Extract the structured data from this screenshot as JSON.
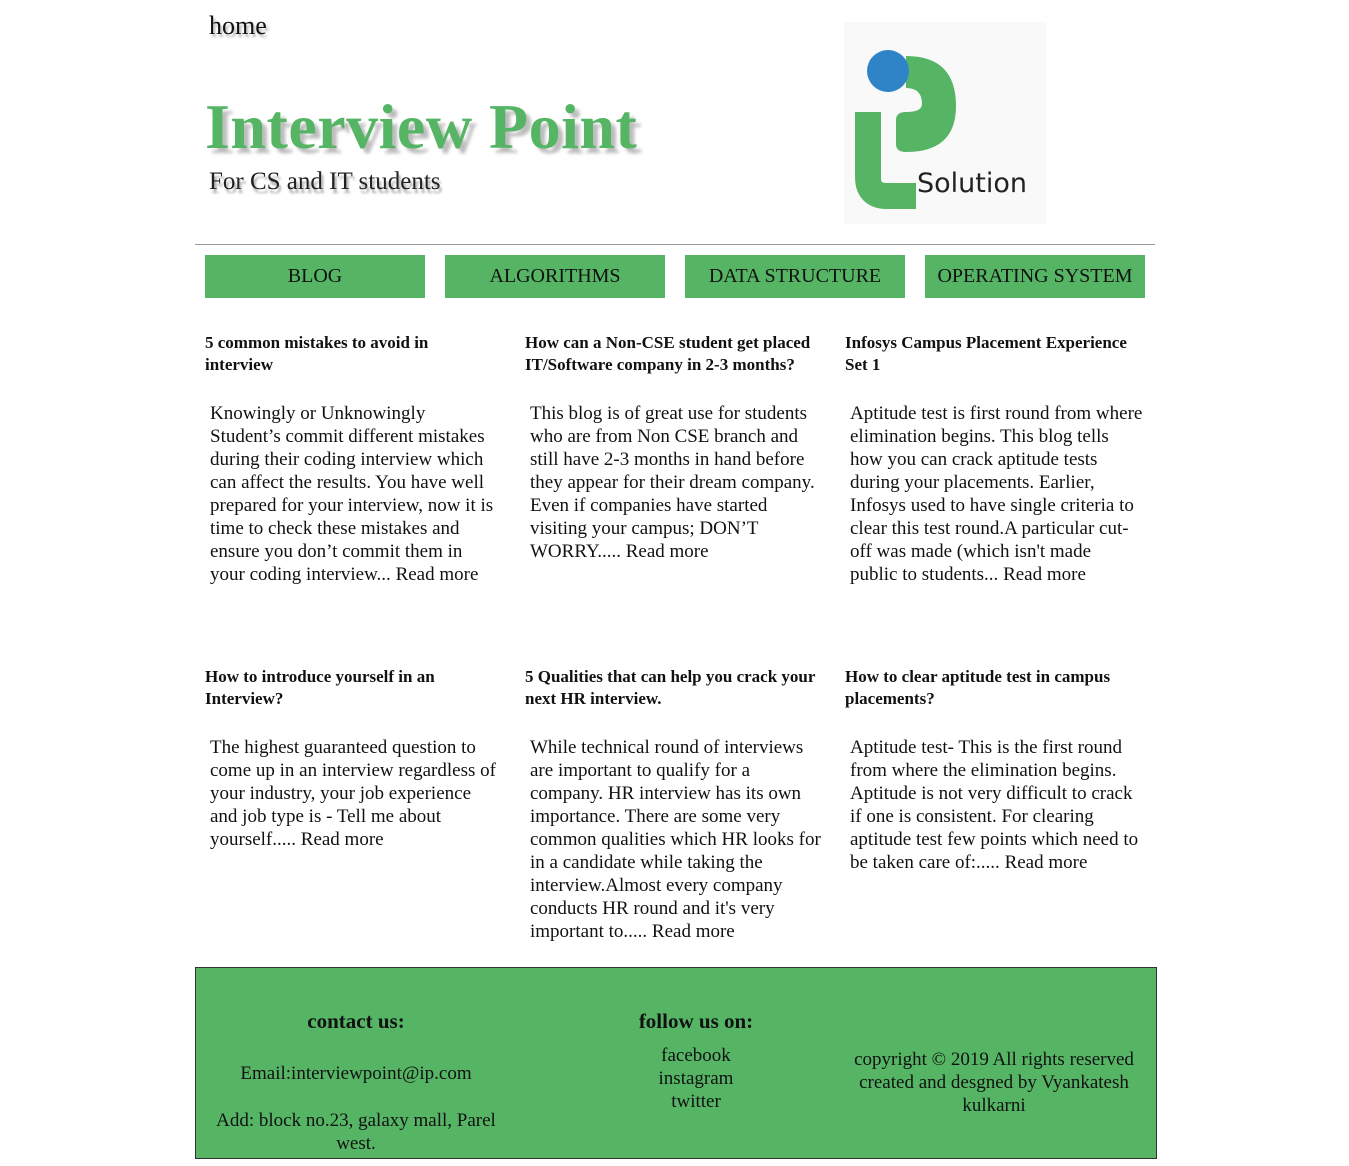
{
  "header": {
    "home_link": "home",
    "title": "Interview Point",
    "tagline": "For CS and IT students",
    "logo_text": "Solution"
  },
  "colors": {
    "brand_green": "#55b565",
    "logo_blue": "#2f84c8"
  },
  "nav": {
    "items": [
      {
        "label": "BLOG"
      },
      {
        "label": "ALGORITHMS"
      },
      {
        "label": "DATA STRUCTURE"
      },
      {
        "label": "OPERATING SYSTEM"
      }
    ]
  },
  "posts": [
    {
      "title": "5 common mistakes to avoid in interview",
      "excerpt": "Knowingly or Unknowingly Student’s commit different mistakes during their coding interview which can affect the results. You have well prepared for your interview, now it is time to check these mistakes and ensure you don’t commit them in your coding interview...",
      "read_more": "Read more"
    },
    {
      "title": "How can a Non-CSE student get placed IT/Software company in 2-3 months?",
      "excerpt": "This blog is of great use for students who are from Non CSE branch and still have 2-3 months in hand before they appear for their dream company. Even if companies have started visiting your campus; DON’T WORRY.....",
      "read_more": "Read more"
    },
    {
      "title": "Infosys Campus Placement Experience Set 1",
      "excerpt": "Aptitude test is first round from where elimination begins. This blog tells how you can crack aptitude tests during your placements. Earlier, Infosys used to have single criteria to clear this test round.A particular cut-off was made (which isn't made public to students...",
      "read_more": "Read more"
    },
    {
      "title": "How to introduce yourself in an Interview?",
      "excerpt": "The highest guaranteed question to come up in an interview regardless of your industry, your job experience and job type is - Tell me about yourself.....",
      "read_more": "Read more"
    },
    {
      "title": "5 Qualities that can help you crack your next HR interview.",
      "excerpt": "While technical round of interviews are important to qualify for a company. HR interview has its own importance. There are some very common qualities which HR looks for in a candidate while taking the interview.Almost every company conducts HR round and it's very important to.....",
      "read_more": "Read more"
    },
    {
      "title": "How to clear aptitude test in campus placements?",
      "excerpt": "Aptitude test- This is the first round from where the elimination begins. Aptitude is not very difficult to crack if one is consistent. For clearing aptitude test few points which need to be taken care of:.....",
      "read_more": "Read more"
    }
  ],
  "footer": {
    "contact_heading": "contact us:",
    "email": "Email:interviewpoint@ip.com",
    "address": "Add: block no.23, galaxy mall, Parel west.",
    "follow_heading": "follow us on:",
    "social": [
      "facebook",
      "instagram",
      "twitter"
    ],
    "copyright": "copyright © 2019 All rights reserved created and desgned by Vyankatesh kulkarni"
  }
}
